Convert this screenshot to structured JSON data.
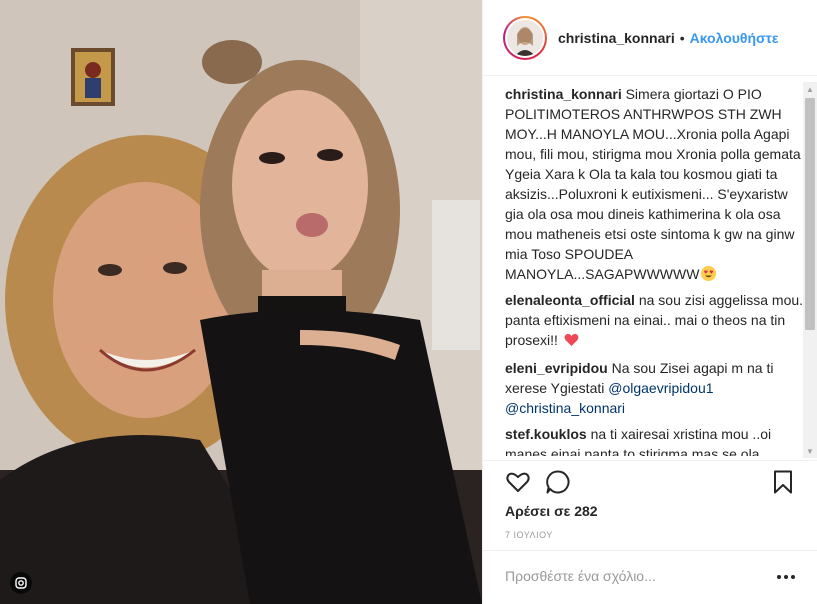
{
  "post": {
    "username": "christina_konnari",
    "separator": "•",
    "follow_label": "Ακολουθήστε"
  },
  "comments": [
    {
      "user": "christina_konnari",
      "text": "Simera giortazi O PIO POLITIMOTEROS ANTHRWPOS STH ZWH MOY...H MANOYLA MOU...Xronia polla Agapi mou, fili mou, stirigma mou Xronia polla gemata Ygeia Xara k Ola ta kala tou kosmou giati ta aksizis...Poluxroni k eutixismeni... S'eyxaristw gia ola osa mou dineis kathimerina k ola osa mou matheneis etsi oste sintoma k gw na ginw mia Toso SPOUDEA MANOYLA...SAGAPWWWWW",
      "emoji": "heart-eyes-emoji"
    },
    {
      "user": "elenaleonta_official",
      "text": "na sou zisi aggelissa mou.. panta eftixismeni na einai.. mai o theos na tin prosexi!!",
      "emoji": "red-heart-emoji"
    },
    {
      "user": "eleni_evripidou",
      "text": "Na sou Zisei agapi m na ti xerese Ygiestati",
      "mentions": [
        "@olgaevripidou1",
        "@christina_konnari"
      ]
    },
    {
      "user": "stef.kouklos",
      "text": "na ti xairesai xristina mou ..oi manes einai panta to.stirigma mas se ola"
    }
  ],
  "likes": {
    "prefix": "Αρέσει σε",
    "count": "282"
  },
  "date": "7 ΙΟΥΛΙΟΥ",
  "add_comment": {
    "placeholder": "Προσθέστε ένα σχόλιο..."
  },
  "colors": {
    "link_blue": "#3897f0",
    "mention_blue": "#003569",
    "text_primary": "#262626",
    "text_muted": "#999999",
    "border": "#efefef",
    "heart_red": "#ed4956"
  },
  "icons": {
    "like": "heart-outline-icon",
    "comment": "speech-bubble-icon",
    "save": "bookmark-icon",
    "more": "ellipsis-icon",
    "photo_badge": "instagram-icon"
  }
}
